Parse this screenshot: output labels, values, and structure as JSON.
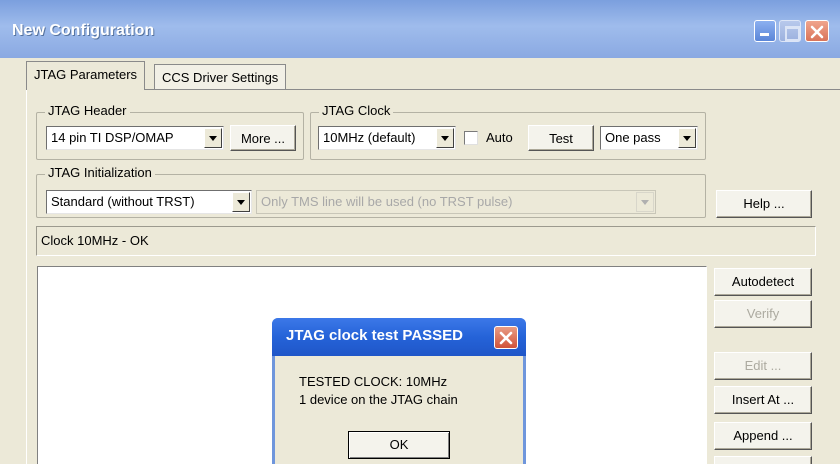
{
  "window": {
    "title": "New Configuration",
    "icons": {
      "minimize": "minimize-icon",
      "maximize": "maximize-icon",
      "close": "close-icon"
    },
    "colors": {
      "titlebar": "#8aa9e2",
      "popup_title": "#2563d8",
      "close_red": "#d9745a"
    }
  },
  "tabs": [
    {
      "label": "JTAG Parameters",
      "active": true
    },
    {
      "label": "CCS Driver Settings",
      "active": false
    }
  ],
  "jtag_header": {
    "legend": "JTAG Header",
    "value": "14 pin TI DSP/OMAP",
    "more_button": "More ..."
  },
  "jtag_clock": {
    "legend": "JTAG Clock",
    "value": "10MHz (default)",
    "auto_label": "Auto",
    "auto_checked": false,
    "test_button": "Test",
    "mode_value": "One pass"
  },
  "jtag_init": {
    "legend": "JTAG Initialization",
    "value": "Standard (without TRST)",
    "description": "Only TMS line will be used (no TRST pulse)"
  },
  "help_button": "Help ...",
  "status_text": "Clock 10MHz - OK",
  "side_buttons": {
    "autodetect": "Autodetect",
    "verify": "Verify",
    "edit": "Edit ...",
    "insert_at": "Insert At ...",
    "append": "Append ..."
  },
  "dialog": {
    "title": "JTAG clock test PASSED",
    "line1": "TESTED CLOCK: 10MHz",
    "line2": "1 device on the JTAG chain",
    "ok_button": "OK"
  }
}
